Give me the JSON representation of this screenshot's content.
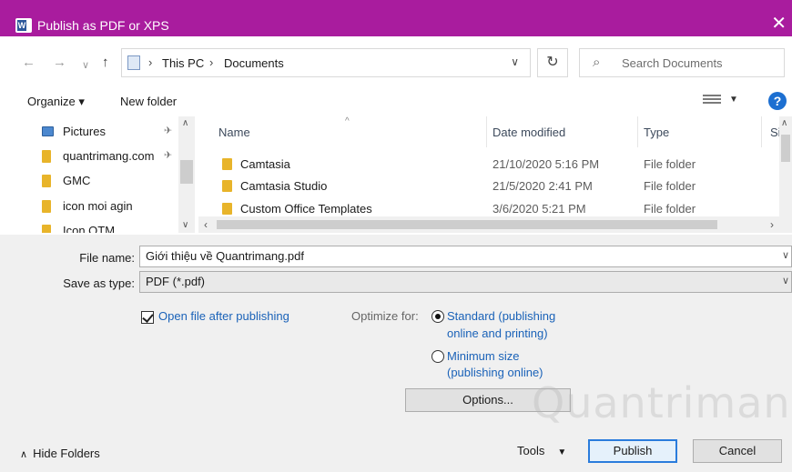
{
  "window": {
    "title": "Publish as PDF or XPS",
    "app_icon": "word-icon",
    "close_glyph": "✕"
  },
  "nav": {
    "back_glyph": "←",
    "forward_glyph": "→",
    "recent_glyph": "∨",
    "up_glyph": "↑",
    "breadcrumb": [
      "This PC",
      "Documents"
    ],
    "search_placeholder": "Search Documents"
  },
  "toolbar": {
    "organize": "Organize ▾",
    "new_folder": "New folder",
    "help": "?"
  },
  "sidebar": {
    "items": [
      {
        "label": "Pictures",
        "icon": "pictures-icon",
        "pinned": true
      },
      {
        "label": "quantrimang.com",
        "icon": "folder-icon",
        "pinned": true
      },
      {
        "label": "GMC",
        "icon": "folder-icon",
        "pinned": false
      },
      {
        "label": "icon moi agin",
        "icon": "folder-icon",
        "pinned": false
      },
      {
        "label": "Icon QTM",
        "icon": "folder-icon",
        "pinned": false
      }
    ]
  },
  "filelist": {
    "columns": {
      "name": "Name",
      "date": "Date modified",
      "type": "Type",
      "size": "Siz"
    },
    "rows": [
      {
        "name": "Camtasia",
        "date": "21/10/2020 5:16 PM",
        "type": "File folder"
      },
      {
        "name": "Camtasia Studio",
        "date": "21/5/2020 2:41 PM",
        "type": "File folder"
      },
      {
        "name": "Custom Office Templates",
        "date": "3/6/2020 5:21 PM",
        "type": "File folder"
      }
    ]
  },
  "form": {
    "file_name_label": "File name:",
    "file_name_value": "Giới thiệu về Quantrimang.pdf",
    "save_type_label": "Save as type:",
    "save_type_value": "PDF (*.pdf)",
    "open_after_label": "Open file after publishing",
    "open_after_checked": true,
    "optimize_label": "Optimize for:",
    "standard_line1": "Standard (publishing",
    "standard_line2": "online and printing)",
    "minimum_line1": "Minimum size",
    "minimum_line2": "(publishing online)",
    "selected_option": "standard",
    "options_button": "Options..."
  },
  "footer": {
    "hide_folders": "Hide Folders",
    "tools": "Tools",
    "publish": "Publish",
    "cancel": "Cancel"
  },
  "watermark": "Quantrimang",
  "colors": {
    "titlebar": "#a91c9e",
    "accent": "#1a62b8",
    "primary_border": "#2a7cdc"
  }
}
